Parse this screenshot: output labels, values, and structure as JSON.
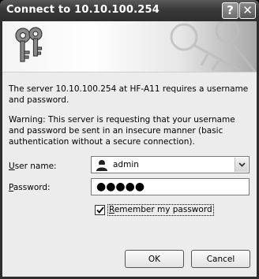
{
  "window": {
    "title": "Connect to 10.10.100.254",
    "help_glyph": "?",
    "close_glyph": "✕"
  },
  "messages": {
    "server": "The server 10.10.100.254 at HF-A11 requires a username and password.",
    "warning": "Warning: This server is requesting that your username and password be sent in an insecure manner (basic authentication without a secure connection)."
  },
  "form": {
    "username_label_mnemonic": "U",
    "username_label_rest": "ser name:",
    "username_value": "admin",
    "password_label_mnemonic": "P",
    "password_label_rest": "assword:",
    "password_value": "●●●●●",
    "remember_label_mnemonic": "R",
    "remember_label_rest": "emember my password",
    "remember_checked": true
  },
  "buttons": {
    "ok": "OK",
    "cancel": "Cancel"
  },
  "icons": {
    "banner": "keys-icon",
    "user": "user-icon",
    "dropdown": "chevron-down-icon",
    "check": "checkmark-icon"
  }
}
